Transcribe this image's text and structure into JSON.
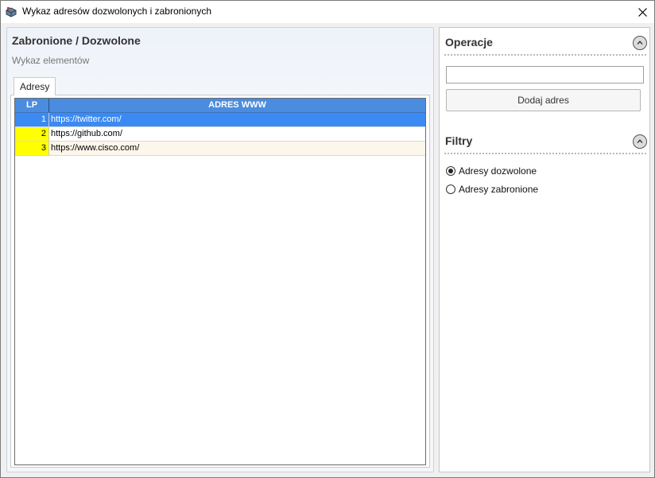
{
  "window": {
    "title": "Wykaz adresów dozwolonych i zabronionych",
    "icon": "app-icon",
    "close_label": "✕"
  },
  "left": {
    "title": "Zabronione / Dozwolone",
    "subtitle": "Wykaz elementów",
    "tab_label": "Adresy",
    "grid": {
      "columns": [
        "LP",
        "ADRES WWW"
      ],
      "rows": [
        {
          "lp": "1",
          "address": "https://twitter.com/",
          "selected": true
        },
        {
          "lp": "2",
          "address": "https://github.com/",
          "selected": false
        },
        {
          "lp": "3",
          "address": "https://www.cisco.com/",
          "selected": false
        }
      ],
      "colors": {
        "header": "#4a8cdf",
        "selected": "#3b8af4",
        "lp_highlight": "#ffff00"
      }
    }
  },
  "right": {
    "operations": {
      "title": "Operacje",
      "input_value": "",
      "add_button": "Dodaj adres"
    },
    "filters": {
      "title": "Filtry",
      "options": [
        {
          "label": "Adresy dozwolone",
          "checked": true
        },
        {
          "label": "Adresy zabronione",
          "checked": false
        }
      ]
    }
  }
}
